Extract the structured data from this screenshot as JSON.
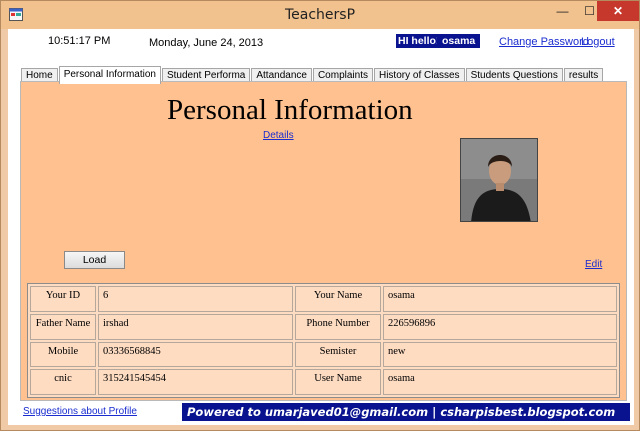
{
  "window": {
    "title": "TeachersP",
    "minimize_glyph": "—",
    "maximize_glyph": "☐",
    "close_glyph": "✕"
  },
  "header": {
    "time": "10:51:17 PM",
    "date": "Monday, June 24, 2013",
    "greeting": "HI hello!",
    "username": "osama",
    "change_password": "Change Password",
    "logout": "Logout"
  },
  "tabs": [
    {
      "label": "Home",
      "active": false
    },
    {
      "label": "Personal Information",
      "active": true
    },
    {
      "label": "Student Performa",
      "active": false
    },
    {
      "label": "Attandance",
      "active": false
    },
    {
      "label": "Complaints",
      "active": false
    },
    {
      "label": "History of Classes",
      "active": false
    },
    {
      "label": "Students Questions",
      "active": false
    },
    {
      "label": "results",
      "active": false
    }
  ],
  "page": {
    "heading": "Personal Information",
    "details_link": "Details",
    "load_button": "Load",
    "edit_link": "Edit",
    "info": {
      "rows": [
        {
          "label1": "Your ID",
          "value1": "6",
          "label2": "Your Name",
          "value2": "osama"
        },
        {
          "label1": "Father Name",
          "value1": "irshad",
          "label2": "Phone Number",
          "value2": "226596896"
        },
        {
          "label1": "Mobile",
          "value1": "03336568845",
          "label2": "Semister",
          "value2": "new"
        },
        {
          "label1": "cnic",
          "value1": "315241545454",
          "label2": "User Name",
          "value2": "osama"
        }
      ]
    }
  },
  "footer": {
    "suggestions_link": "Suggestions about Profile",
    "powered_text": "Powered to umarjaved01@gmail.com | csharpisbest.blogspot.com"
  },
  "colors": {
    "titlebar": "#f2c28e",
    "tabpage_bg": "#ffc190",
    "badge_bg": "#0a138f",
    "link": "#1a2ccf",
    "close_button": "#c7382c"
  },
  "icons": {
    "app": "app-icon",
    "photo": "profile-photo"
  }
}
